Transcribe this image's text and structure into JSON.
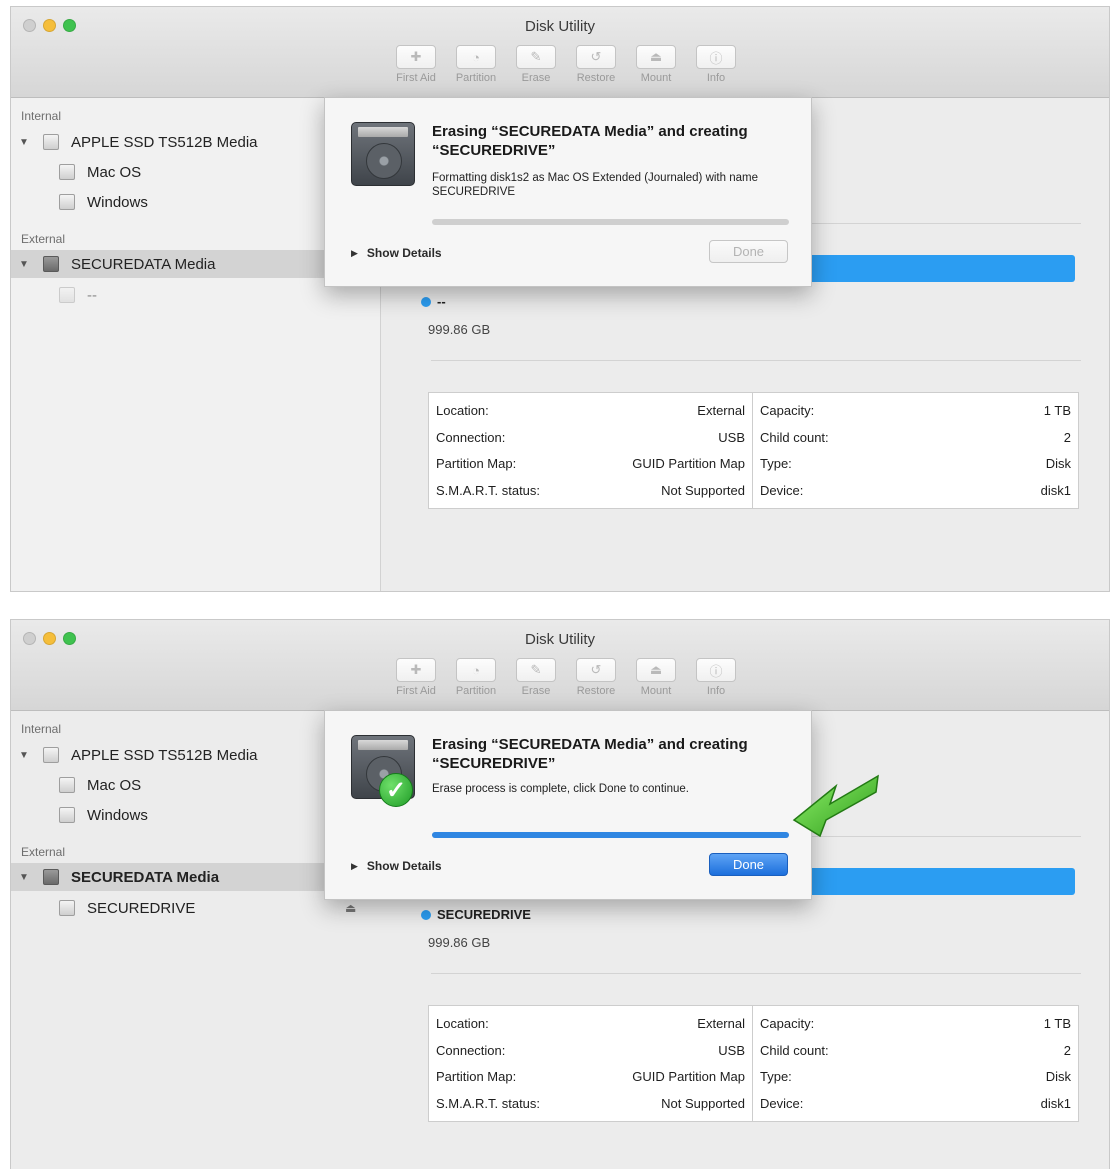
{
  "colors": {
    "accent_blue": "#2b9df2",
    "progress_blue": "#2f86e2",
    "traffic_close": "#cfcfcf",
    "traffic_minimize": "#f5be3b",
    "traffic_maximize": "#3fc24f",
    "arrow_green": "#3fbe2a"
  },
  "screens": [
    {
      "window_title": "Disk Utility",
      "toolbar": [
        {
          "label": "First Aid",
          "icon": "stethoscope-icon",
          "glyph": "✚"
        },
        {
          "label": "Partition",
          "icon": "pie-chart-icon",
          "glyph": "◔"
        },
        {
          "label": "Erase",
          "icon": "erase-icon",
          "glyph": "✎"
        },
        {
          "label": "Restore",
          "icon": "restore-icon",
          "glyph": "↺"
        },
        {
          "label": "Mount",
          "icon": "mount-icon",
          "glyph": "⏏"
        },
        {
          "label": "Info",
          "icon": "info-icon",
          "glyph": "ⓘ"
        }
      ],
      "sidebar": {
        "internal_label": "Internal",
        "internal_disk": "APPLE SSD TS512B Media",
        "internal_volumes": [
          "Mac OS",
          "Windows"
        ],
        "external_label": "External",
        "external_disk": "SECUREDATA Media",
        "external_volume": "--"
      },
      "volume": {
        "name": "--",
        "size": "999.86 GB"
      },
      "info_table": {
        "left": [
          {
            "label": "Location:",
            "value": "External"
          },
          {
            "label": "Connection:",
            "value": "USB"
          },
          {
            "label": "Partition Map:",
            "value": "GUID Partition Map"
          },
          {
            "label": "S.M.A.R.T. status:",
            "value": "Not Supported"
          }
        ],
        "right": [
          {
            "label": "Capacity:",
            "value": "1 TB"
          },
          {
            "label": "Child count:",
            "value": "2"
          },
          {
            "label": "Type:",
            "value": "Disk"
          },
          {
            "label": "Device:",
            "value": "disk1"
          }
        ]
      },
      "dialog": {
        "title": "Erasing “SECUREDATA Media” and creating “SECUREDRIVE”",
        "message": "Formatting disk1s2 as Mac OS Extended (Journaled) with name SECUREDRIVE",
        "progress": 0,
        "show_details": "Show Details",
        "done_button": "Done",
        "done_enabled": false
      }
    },
    {
      "window_title": "Disk Utility",
      "toolbar": [
        {
          "label": "First Aid",
          "icon": "stethoscope-icon",
          "glyph": "✚"
        },
        {
          "label": "Partition",
          "icon": "pie-chart-icon",
          "glyph": "◔"
        },
        {
          "label": "Erase",
          "icon": "erase-icon",
          "glyph": "✎"
        },
        {
          "label": "Restore",
          "icon": "restore-icon",
          "glyph": "↺"
        },
        {
          "label": "Mount",
          "icon": "mount-icon",
          "glyph": "⏏"
        },
        {
          "label": "Info",
          "icon": "info-icon",
          "glyph": "ⓘ"
        }
      ],
      "sidebar": {
        "internal_label": "Internal",
        "internal_disk": "APPLE SSD TS512B Media",
        "internal_volumes": [
          "Mac OS",
          "Windows"
        ],
        "external_label": "External",
        "external_disk": "SECUREDATA Media",
        "external_volume": "SECUREDRIVE"
      },
      "volume": {
        "name": "SECUREDRIVE",
        "size": "999.86 GB"
      },
      "info_table": {
        "left": [
          {
            "label": "Location:",
            "value": "External"
          },
          {
            "label": "Connection:",
            "value": "USB"
          },
          {
            "label": "Partition Map:",
            "value": "GUID Partition Map"
          },
          {
            "label": "S.M.A.R.T. status:",
            "value": "Not Supported"
          }
        ],
        "right": [
          {
            "label": "Capacity:",
            "value": "1 TB"
          },
          {
            "label": "Child count:",
            "value": "2"
          },
          {
            "label": "Type:",
            "value": "Disk"
          },
          {
            "label": "Device:",
            "value": "disk1"
          }
        ]
      },
      "dialog": {
        "title": "Erasing “SECUREDATA Media” and creating “SECUREDRIVE”",
        "message": "Erase process is complete, click Done to continue.",
        "progress": 1,
        "show_details": "Show Details",
        "done_button": "Done",
        "done_enabled": true
      }
    }
  ]
}
